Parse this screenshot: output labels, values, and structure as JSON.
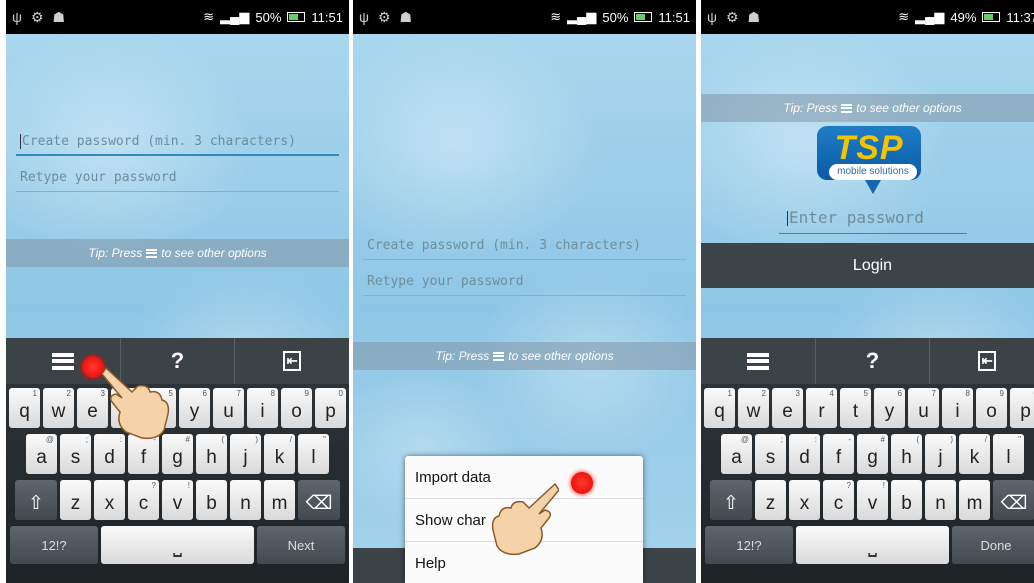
{
  "status": [
    {
      "battery": "50%",
      "time": "11:51"
    },
    {
      "battery": "50%",
      "time": "11:51"
    },
    {
      "battery": "49%",
      "time": "11:37"
    }
  ],
  "form": {
    "create_placeholder": "Create password (min. 3 characters)",
    "retype_placeholder": "Retype your password"
  },
  "tip": {
    "before": "Tip: Press",
    "after": "to see other options"
  },
  "toolbar": {
    "help_label": "?"
  },
  "keyboard": {
    "row1": [
      {
        "k": "q",
        "s": "1"
      },
      {
        "k": "w",
        "s": "2"
      },
      {
        "k": "e",
        "s": "3"
      },
      {
        "k": "r",
        "s": "4"
      },
      {
        "k": "t",
        "s": "5"
      },
      {
        "k": "y",
        "s": "6"
      },
      {
        "k": "u",
        "s": "7"
      },
      {
        "k": "i",
        "s": "8"
      },
      {
        "k": "o",
        "s": "9"
      },
      {
        "k": "p",
        "s": "0"
      }
    ],
    "row2": [
      {
        "k": "a",
        "s": "@"
      },
      {
        "k": "s",
        "s": ";"
      },
      {
        "k": "d",
        "s": ":"
      },
      {
        "k": "f",
        "s": "-"
      },
      {
        "k": "g",
        "s": "#"
      },
      {
        "k": "h",
        "s": "("
      },
      {
        "k": "j",
        "s": ")"
      },
      {
        "k": "k",
        "s": "/"
      },
      {
        "k": "l",
        "s": "\""
      }
    ],
    "row3": [
      {
        "k": "z",
        "s": ""
      },
      {
        "k": "x",
        "s": ""
      },
      {
        "k": "c",
        "s": "?"
      },
      {
        "k": "v",
        "s": "!"
      },
      {
        "k": "b",
        "s": ""
      },
      {
        "k": "n",
        "s": ""
      },
      {
        "k": "m",
        "s": ""
      }
    ],
    "sym_label": "12!?",
    "next_label": "Next",
    "done_label": "Done"
  },
  "menu": {
    "items": [
      "Import data",
      "Show char",
      "Help"
    ]
  },
  "login": {
    "brand": "TSP",
    "tagline": "mobile solutions",
    "password_placeholder": "Enter password",
    "login_label": "Login"
  }
}
